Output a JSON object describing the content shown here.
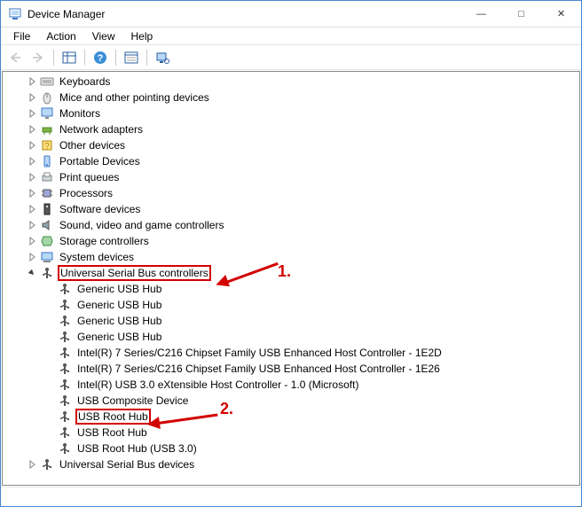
{
  "window": {
    "title": "Device Manager"
  },
  "menu": {
    "file": "File",
    "action": "Action",
    "view": "View",
    "help": "Help"
  },
  "tree": {
    "nodes": [
      {
        "label": "Keyboards",
        "icon": "keyboard",
        "expand": "collapsed"
      },
      {
        "label": "Mice and other pointing devices",
        "icon": "mouse",
        "expand": "collapsed"
      },
      {
        "label": "Monitors",
        "icon": "monitor",
        "expand": "collapsed"
      },
      {
        "label": "Network adapters",
        "icon": "network",
        "expand": "collapsed"
      },
      {
        "label": "Other devices",
        "icon": "other",
        "expand": "collapsed"
      },
      {
        "label": "Portable Devices",
        "icon": "portable",
        "expand": "collapsed"
      },
      {
        "label": "Print queues",
        "icon": "printer",
        "expand": "collapsed"
      },
      {
        "label": "Processors",
        "icon": "cpu",
        "expand": "collapsed"
      },
      {
        "label": "Software devices",
        "icon": "software",
        "expand": "collapsed"
      },
      {
        "label": "Sound, video and game controllers",
        "icon": "sound",
        "expand": "collapsed"
      },
      {
        "label": "Storage controllers",
        "icon": "storage",
        "expand": "collapsed"
      },
      {
        "label": "System devices",
        "icon": "system",
        "expand": "collapsed"
      },
      {
        "label": "Universal Serial Bus controllers",
        "icon": "usb",
        "expand": "expanded",
        "highlight": true,
        "children": [
          {
            "label": "Generic USB Hub",
            "icon": "usb"
          },
          {
            "label": "Generic USB Hub",
            "icon": "usb"
          },
          {
            "label": "Generic USB Hub",
            "icon": "usb"
          },
          {
            "label": "Generic USB Hub",
            "icon": "usb"
          },
          {
            "label": "Intel(R) 7 Series/C216 Chipset Family USB Enhanced Host Controller - 1E2D",
            "icon": "usb"
          },
          {
            "label": "Intel(R) 7 Series/C216 Chipset Family USB Enhanced Host Controller - 1E26",
            "icon": "usb"
          },
          {
            "label": "Intel(R) USB 3.0 eXtensible Host Controller - 1.0 (Microsoft)",
            "icon": "usb"
          },
          {
            "label": "USB Composite Device",
            "icon": "usb"
          },
          {
            "label": "USB Root Hub",
            "icon": "usb",
            "highlight": true
          },
          {
            "label": "USB Root Hub",
            "icon": "usb"
          },
          {
            "label": "USB Root Hub (USB 3.0)",
            "icon": "usb"
          }
        ]
      },
      {
        "label": "Universal Serial Bus devices",
        "icon": "usb",
        "expand": "collapsed"
      }
    ]
  },
  "annotations": {
    "n1": "1.",
    "n2": "2."
  }
}
